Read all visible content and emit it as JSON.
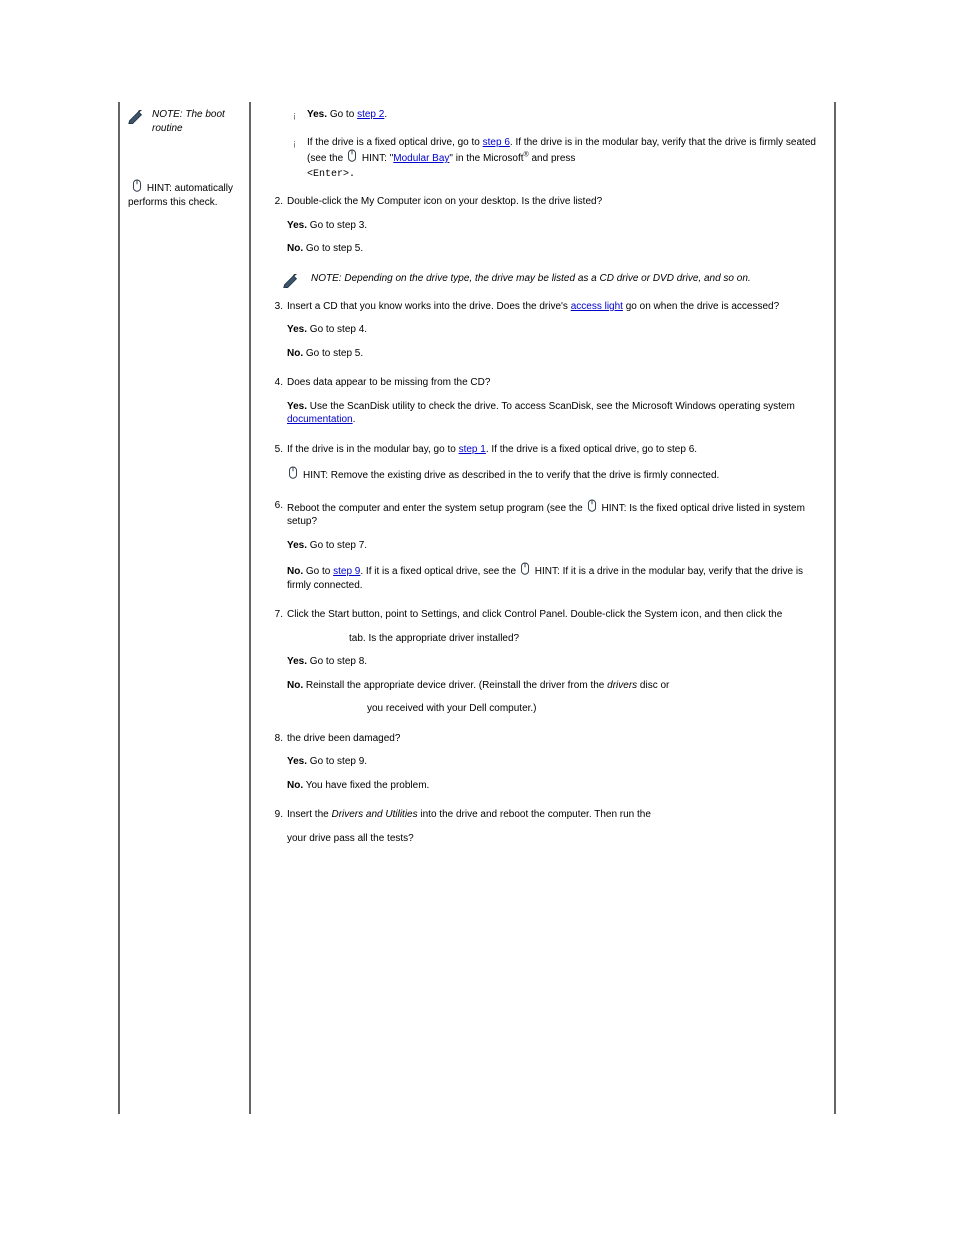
{
  "left": {
    "note1": {
      "label": "NOTE:",
      "text": "The boot routine"
    },
    "hint_ref_label": "HINT:",
    "hint_ref_tail": "automatically",
    "last_line": "performs this check."
  },
  "right": {
    "sub2": {
      "label": "Yes.",
      "text_before": "Go to ",
      "link": "step 2",
      "text_after": "."
    },
    "sub3": {
      "before_link1": "If the drive is a fixed optical drive, go to ",
      "link1": "step 6",
      "between": ". If the drive is in the modular bay, verify that the drive is firmly seated (see the ",
      "hint_label": "HINT:",
      "after_hint": " \"",
      "link2": "Modular Bay",
      "tail": "\" in the Microsoft",
      "reg": "®",
      "after_reg": " and press ",
      "enter": "<Enter>."
    },
    "step2": {
      "num": "2.",
      "body": "Double-click the My Computer icon on your desktop. Is the drive listed?"
    },
    "step2_yn": {
      "yes": "Yes.",
      "yes_text": " Go to step 3.",
      "no": "No.",
      "no_text": " Go to step 5."
    },
    "note2": {
      "label": "NOTE:",
      "text": "Depending on the drive type, the drive may be listed as a CD drive or DVD drive, and so on."
    },
    "step3": {
      "num": "3.",
      "body_before": "Insert a CD that you know works into the drive. Does the drive's ",
      "link": "access light",
      "body_after": " go on when the drive is accessed?"
    },
    "step3_yn": {
      "yes": "Yes.",
      "yes_text": " Go to step 4.",
      "no": "No.",
      "no_text": " Go to step 5."
    },
    "step4": {
      "num": "4.",
      "body": "Does data appear to be missing from the CD?"
    },
    "step4_y": {
      "yes": "Yes.",
      "before_link": " Use the ScanDisk utility to check the drive. To access ScanDisk, see the Microsoft Windows operating system ",
      "link": "documentation",
      "after_link": "."
    },
    "step5": {
      "num": "5.",
      "before_link": "If the drive is in the modular bay, go to ",
      "link": "step 1",
      "after_link": ". If the drive is a fixed optical drive, go to step 6.",
      "hint": "HINT:",
      "hint_text": " Remove the existing drive as described in the to verify that the drive is firmly connected."
    },
    "step6": {
      "num": "6.",
      "p1_before": "Reboot the computer and enter the system setup program (see the ",
      "p1_hint": "HINT:",
      "p1_after": " Is the fixed optical drive listed in system setup?",
      "yes": "Yes.",
      "yes_text": " Go to step 7.",
      "no": "No.",
      "no_before_link": " Go to ",
      "no_link": "step 9",
      "no_after_link": ". If it is a fixed optical drive, see the ",
      "no_hint": "HINT:",
      "no_tail": " If it is a drive in the modular bay, verify that the drive is firmly connected."
    },
    "step7": {
      "num": "7.",
      "p1": "Click the Start button, point to Settings, and click Control Panel. Double-click the System icon, and then click the",
      "p2": "tab. Is the appropriate driver installed?",
      "yes": "Yes.",
      "yes_text": " Go to step 8.",
      "no": "No.",
      "no_text_before": " Reinstall the appropriate device driver. (Reinstall the driver from the ",
      "no_italic": "drivers",
      "no_text_after": " disc or",
      "no_line2": "you received with your Dell computer.)"
    },
    "step8": {
      "num": "8.",
      "p1": "the drive been damaged?",
      "yes": "Yes.",
      "yes_text": " Go to step 9.",
      "no": "No.",
      "no_text": " You have fixed the problem."
    },
    "step9": {
      "num": "9.",
      "p1_before": "Insert the ",
      "p1_italic": "Drivers and Utilities",
      "p1_after": " into the drive and reboot the computer. Then run the",
      "p2": "your  drive pass all the tests?"
    }
  }
}
